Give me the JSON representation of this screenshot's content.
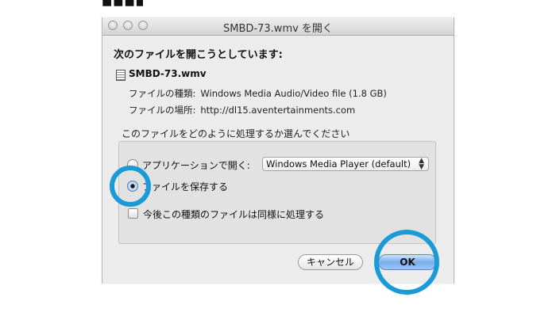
{
  "window": {
    "title": "SMBD-73.wmv を開く"
  },
  "dialog": {
    "heading": "次のファイルを開こうとしています:",
    "file_name": "SMBD-73.wmv",
    "type_label": "ファイルの種類:",
    "type_value": "Windows Media Audio/Video file (1.8  GB)",
    "location_label": "ファイルの場所:",
    "location_value": "http://dl15.aventertainments.com",
    "prompt": "このファイルをどのように処理するか選んでください"
  },
  "options": {
    "open_with_label": "アプリケーションで開く:",
    "app_selected": "Windows Media Player (default)",
    "save_label": "ファイルを保存する",
    "selected_option": "save",
    "remember_label": "今後この種類のファイルは同様に処理する",
    "remember_checked": false
  },
  "buttons": {
    "cancel": "キャンセル",
    "ok": "OK"
  },
  "colors": {
    "highlight_ring": "#1a9bd7",
    "ok_button": "#79adea"
  },
  "icons": [
    "close-button",
    "minimize-button",
    "zoom-button",
    "file-icon",
    "chevron-updown-icon"
  ]
}
